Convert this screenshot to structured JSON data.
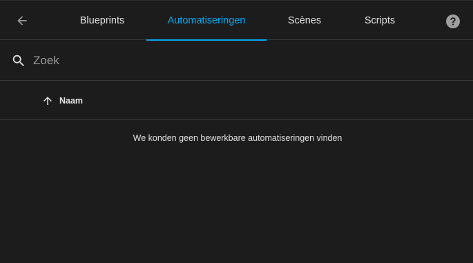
{
  "tabs": [
    {
      "label": "Blueprints",
      "active": false
    },
    {
      "label": "Automatiseringen",
      "active": true
    },
    {
      "label": "Scènes",
      "active": false
    },
    {
      "label": "Scripts",
      "active": false
    }
  ],
  "toolbar": {
    "back_icon": "arrow-left-icon",
    "help_icon": "help-circle-icon"
  },
  "search": {
    "placeholder": "Zoek",
    "value": "",
    "icon": "search-icon"
  },
  "table": {
    "columns": [
      {
        "label": "Naam",
        "sort": "ascending",
        "sort_icon": "arrow-up-icon"
      }
    ],
    "rows": [],
    "empty_message": "We konden geen bewerkbare automatiseringen vinden"
  },
  "colors": {
    "background": "#1c1c1c",
    "accent": "#03a9f4",
    "text": "#e1e1e1",
    "muted": "#9b9b9b",
    "divider": "#3a3a3a"
  }
}
